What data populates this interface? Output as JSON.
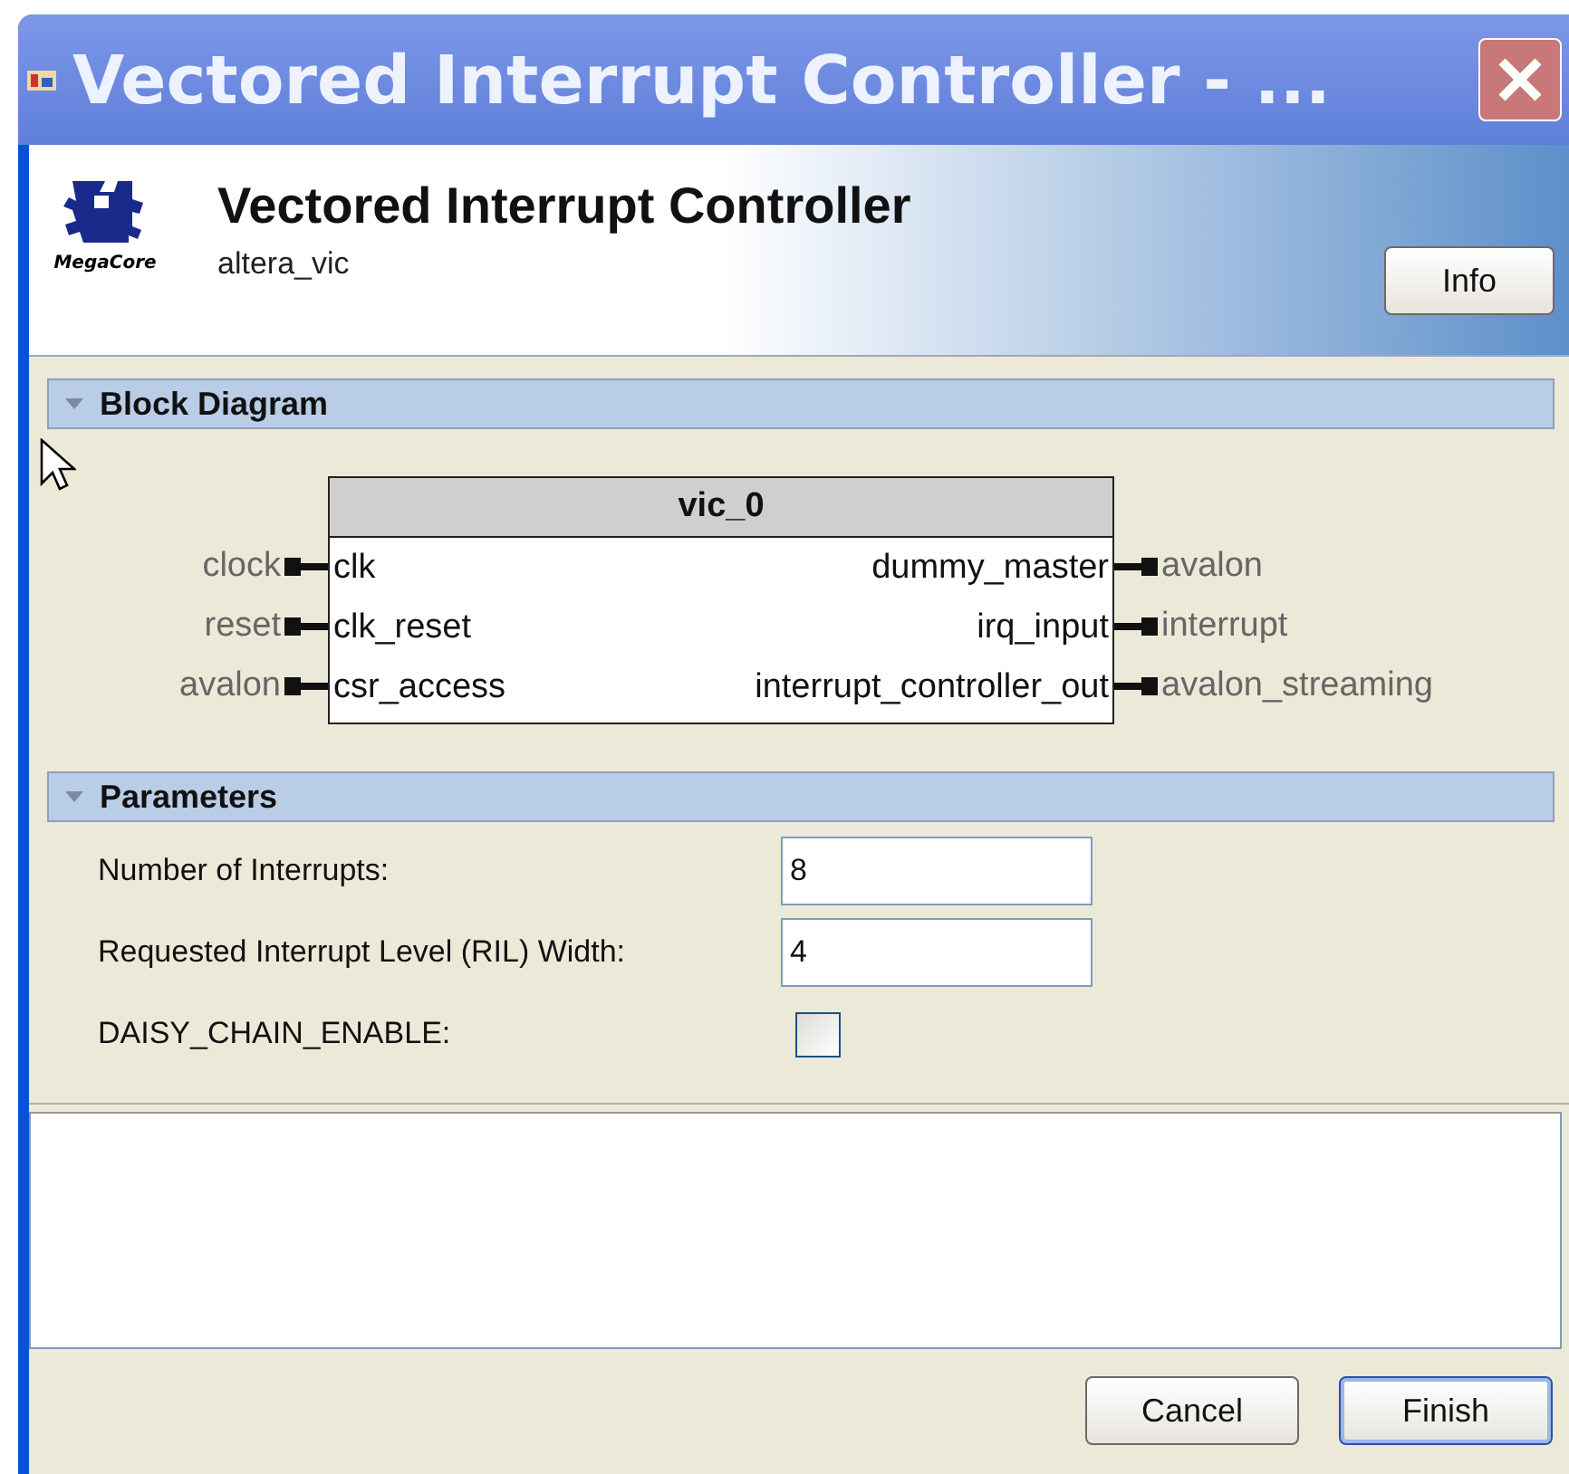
{
  "window": {
    "title": "Vectored Interrupt Controller - ..."
  },
  "header": {
    "logo_text": "MegaCore",
    "title": "Vectored Interrupt Controller",
    "subtitle": "altera_vic",
    "info_button": "Info"
  },
  "block_diagram": {
    "heading": "Block Diagram",
    "expanded": true,
    "component": "vic_0",
    "inputs": [
      {
        "external": "clock",
        "port": "clk"
      },
      {
        "external": "reset",
        "port": "clk_reset"
      },
      {
        "external": "avalon",
        "port": "csr_access"
      }
    ],
    "outputs": [
      {
        "port": "dummy_master",
        "external": "avalon"
      },
      {
        "port": "irq_input",
        "external": "interrupt"
      },
      {
        "port": "interrupt_controller_out",
        "external": "avalon_streaming"
      }
    ]
  },
  "parameters": {
    "heading": "Parameters",
    "expanded": true,
    "items": [
      {
        "kind": "text",
        "label": "Number of Interrupts:",
        "value": "8"
      },
      {
        "kind": "text",
        "label": "Requested Interrupt Level (RIL) Width:",
        "value": "4"
      },
      {
        "kind": "checkbox",
        "label": "DAISY_CHAIN_ENABLE:",
        "checked": false
      }
    ]
  },
  "buttons": [
    {
      "label": "Cancel",
      "default": false
    },
    {
      "label": "Finish",
      "default": true
    }
  ]
}
